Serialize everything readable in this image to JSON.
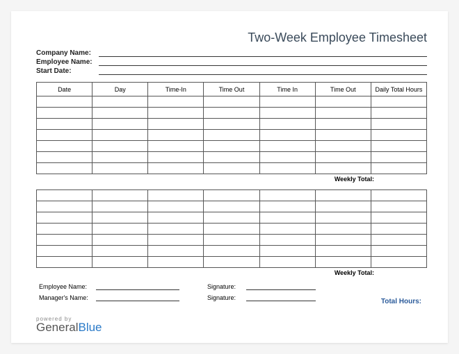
{
  "title": "Two-Week Employee Timesheet",
  "meta": {
    "company_label": "Company Name:",
    "employee_label": "Employee Name:",
    "startdate_label": "Start Date:"
  },
  "columns": [
    "Date",
    "Day",
    "Time-In",
    "Time Out",
    "Time In",
    "Time Out",
    "Daily Total Hours"
  ],
  "weekly_total_label": "Weekly Total:",
  "signatures": {
    "employee_label": "Employee Name:",
    "manager_label": "Manager's Name:",
    "signature_label": "Signature:"
  },
  "total_hours_label": "Total Hours:",
  "branding": {
    "powered": "powered by",
    "general": "General",
    "blue": "Blue"
  }
}
